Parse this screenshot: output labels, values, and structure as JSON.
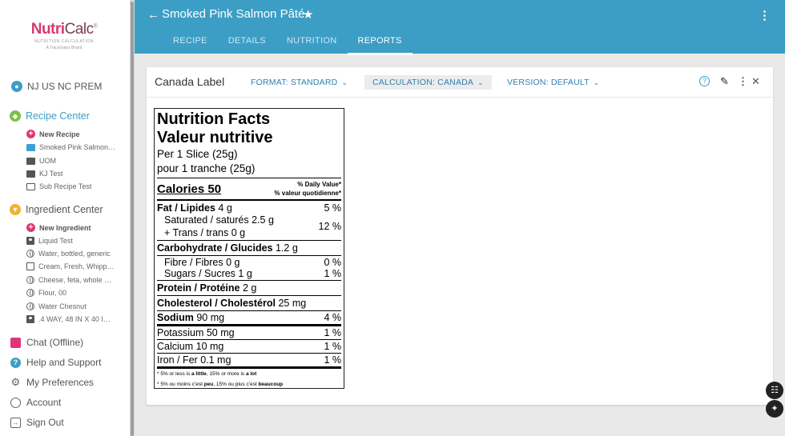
{
  "app": {
    "logo_main": "Nutri",
    "logo_main2": "Calc",
    "logo_reg": "®",
    "logo_sub": "NUTRITION CALCULATION",
    "logo_sub2": "A TraceGains Brand"
  },
  "sidebar": {
    "account_name": "NJ US NC PREM",
    "recipe_center": {
      "label": "Recipe Center",
      "items": [
        {
          "label": "New Recipe",
          "icon": "plus-icon"
        },
        {
          "label": "Smoked Pink Salmon…",
          "icon": "folder-blue-icon"
        },
        {
          "label": "UOM",
          "icon": "folder-icon"
        },
        {
          "label": "KJ Test",
          "icon": "folder-icon"
        },
        {
          "label": "Sub Recipe Test",
          "icon": "folder-outline-icon"
        }
      ]
    },
    "ingredient_center": {
      "label": "Ingredient Center",
      "items": [
        {
          "label": "New Ingredient",
          "icon": "plus-icon"
        },
        {
          "label": "Liquid Test",
          "icon": "person-box-icon"
        },
        {
          "label": "Water, bottled, generic",
          "icon": "globe-icon"
        },
        {
          "label": "Cream, Fresh, Whipp…",
          "icon": "copy-icon"
        },
        {
          "label": "Cheese, feta, whole …",
          "icon": "globe-icon"
        },
        {
          "label": "Flour, 00",
          "icon": "globe-icon"
        },
        {
          "label": "Water Chesnut",
          "icon": "globe-icon"
        },
        {
          "label": ".4 WAY, 48 IN X 40 I…",
          "icon": "person-box-icon"
        }
      ]
    },
    "links": [
      {
        "label": "Chat (Offline)",
        "icon": "chat-icon"
      },
      {
        "label": "Help and Support",
        "icon": "help-icon"
      },
      {
        "label": "My Preferences",
        "icon": "gear-icon"
      },
      {
        "label": "Account",
        "icon": "account-icon"
      },
      {
        "label": "Sign Out",
        "icon": "sign-out-icon"
      }
    ]
  },
  "header": {
    "title": "Smoked Pink Salmon Pâté",
    "tabs": [
      {
        "label": "RECIPE",
        "active": false
      },
      {
        "label": "DETAILS",
        "active": false
      },
      {
        "label": "NUTRITION",
        "active": false
      },
      {
        "label": "REPORTS",
        "active": true
      }
    ],
    "bg_color": "#3c9ec5"
  },
  "card": {
    "title": "Canada Label",
    "format_label": "FORMAT: STANDARD",
    "calculation_label": "CALCULATION: CANADA",
    "version_label": "VERSION: DEFAULT"
  },
  "label": {
    "title_en": "Nutrition Facts",
    "title_fr": "Valeur nutritive",
    "serving_en": "Per 1 Slice (25g)",
    "serving_fr": "pour 1 tranche (25g)",
    "calories_label": "Calories",
    "calories_value": "50",
    "dv_en": "% Daily Value",
    "dv_fr": "% valeur quotidienne",
    "fat": {
      "name": "Fat / Lipides",
      "amount": "4 g",
      "dv": "5 %"
    },
    "sat": {
      "name": "Saturated / saturés",
      "amount": "2.5 g"
    },
    "trans": {
      "name": "+ Trans / trans",
      "amount": "0 g"
    },
    "sat_trans_dv": "12 %",
    "carb": {
      "name": "Carbohydrate / Glucides",
      "amount": "1.2 g"
    },
    "fibre": {
      "name": "Fibre / Fibres",
      "amount": "0 g",
      "dv": "0 %"
    },
    "sugars": {
      "name": "Sugars / Sucres",
      "amount": "1 g",
      "dv": "1 %"
    },
    "protein": {
      "name": "Protein / Protéine",
      "amount": "2 g"
    },
    "cholesterol": {
      "name": "Cholesterol / Cholestérol",
      "amount": "25 mg"
    },
    "sodium": {
      "name": "Sodium",
      "amount": "90 mg",
      "dv": "4 %"
    },
    "potassium": {
      "name": "Potassium",
      "amount": "50 mg",
      "dv": "1 %"
    },
    "calcium": {
      "name": "Calcium",
      "amount": "10 mg",
      "dv": "1 %"
    },
    "iron": {
      "name": "Iron / Fer",
      "amount": "0.1 mg",
      "dv": "1 %"
    },
    "foot_en_1": "5% or less is",
    "foot_en_2": "a little",
    "foot_en_3": ", 15% or more is",
    "foot_en_4": "a lot",
    "foot_fr_1": "5% ou moins c'est",
    "foot_fr_2": "peu",
    "foot_fr_3": ", 15% ou plus c'est",
    "foot_fr_4": "beaucoup"
  }
}
